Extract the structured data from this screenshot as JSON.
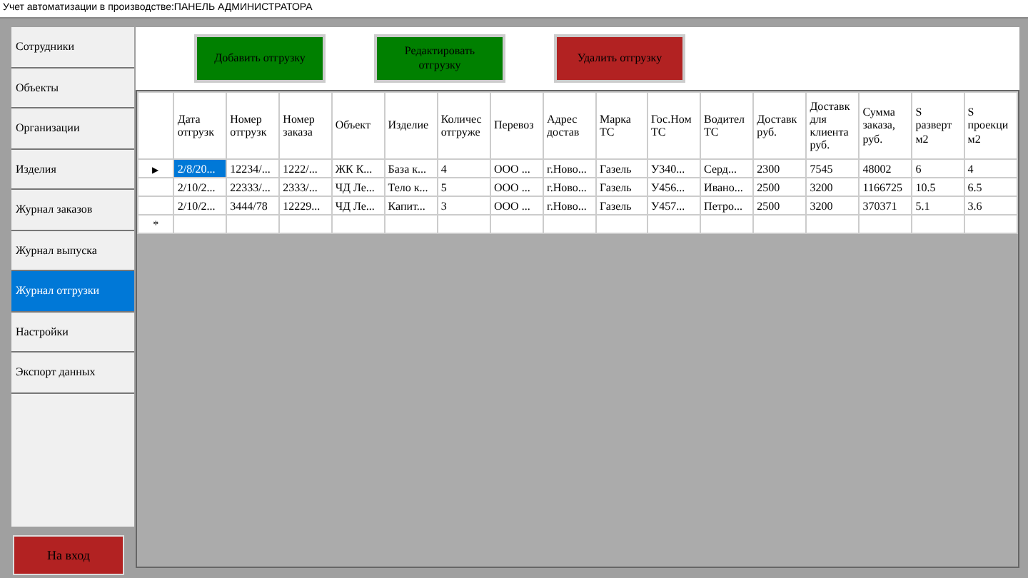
{
  "window": {
    "title": "Учет автоматизации в производстве:ПАНЕЛЬ АДМИНИСТРАТОРА"
  },
  "sidebar": {
    "items": [
      {
        "label": "Сотрудники",
        "selected": false
      },
      {
        "label": "Объекты",
        "selected": false
      },
      {
        "label": "Организации",
        "selected": false
      },
      {
        "label": "Изделия",
        "selected": false
      },
      {
        "label": "Журнал заказов",
        "selected": false
      },
      {
        "label": "Журнал выпуска",
        "selected": false
      },
      {
        "label": "Журнал отгрузки",
        "selected": true
      },
      {
        "label": "Настройки",
        "selected": false
      },
      {
        "label": "Экспорт данных",
        "selected": false
      }
    ]
  },
  "toolbar": {
    "buttons": [
      {
        "label": "Добавить отгрузку",
        "color": "#008000"
      },
      {
        "label": "Редактировать отгрузку",
        "color": "#008000"
      },
      {
        "label": "Удалить отгрузку",
        "color": "#b22222"
      }
    ]
  },
  "table": {
    "columns": [
      "Дата\nотгрузк",
      "Номер\nотгрузк",
      "Номер\nзаказа",
      "Объект",
      "Изделие",
      "Количес\nотгруже",
      "Перевоз",
      "Адрес\nдостав",
      "Марка\nТС",
      "Гос.Ном\nТС",
      "Водител\nТС",
      "Доставк\nруб.",
      "Доставк\nдля\nклиента\nруб.",
      "Сумма\nзаказа,\nруб.",
      "S\nразверт\nм2",
      "S\nпроекци\nм2"
    ],
    "rows": [
      {
        "selected": true,
        "marker": "▶",
        "cells": [
          "2/8/20...",
          "12234/...",
          "1222/...",
          "ЖК К...",
          "База к...",
          "4",
          "ООО ...",
          "г.Ново...",
          "Газель",
          "У340...",
          "Серд...",
          "2300",
          "7545",
          "48002",
          "6",
          "4"
        ]
      },
      {
        "selected": false,
        "cells": [
          "2/10/2...",
          "22333/...",
          "2333/...",
          "ЧД Ле...",
          "Тело к...",
          "5",
          "ООО ...",
          "г.Ново...",
          "Газель",
          "У456...",
          "Ивано...",
          "2500",
          "3200",
          "1166725",
          "10.5",
          "6.5"
        ]
      },
      {
        "selected": false,
        "cells": [
          "2/10/2...",
          "3444/78",
          "12229...",
          "ЧД Ле...",
          "Капит...",
          "3",
          "ООО ...",
          "г.Ново...",
          "Газель",
          "У457...",
          "Петро...",
          "2500",
          "3200",
          "370371",
          "5.1",
          "3.6"
        ]
      }
    ],
    "new_row_marker": "*"
  },
  "exit_button": {
    "label": "На вход",
    "color": "#b22222"
  }
}
